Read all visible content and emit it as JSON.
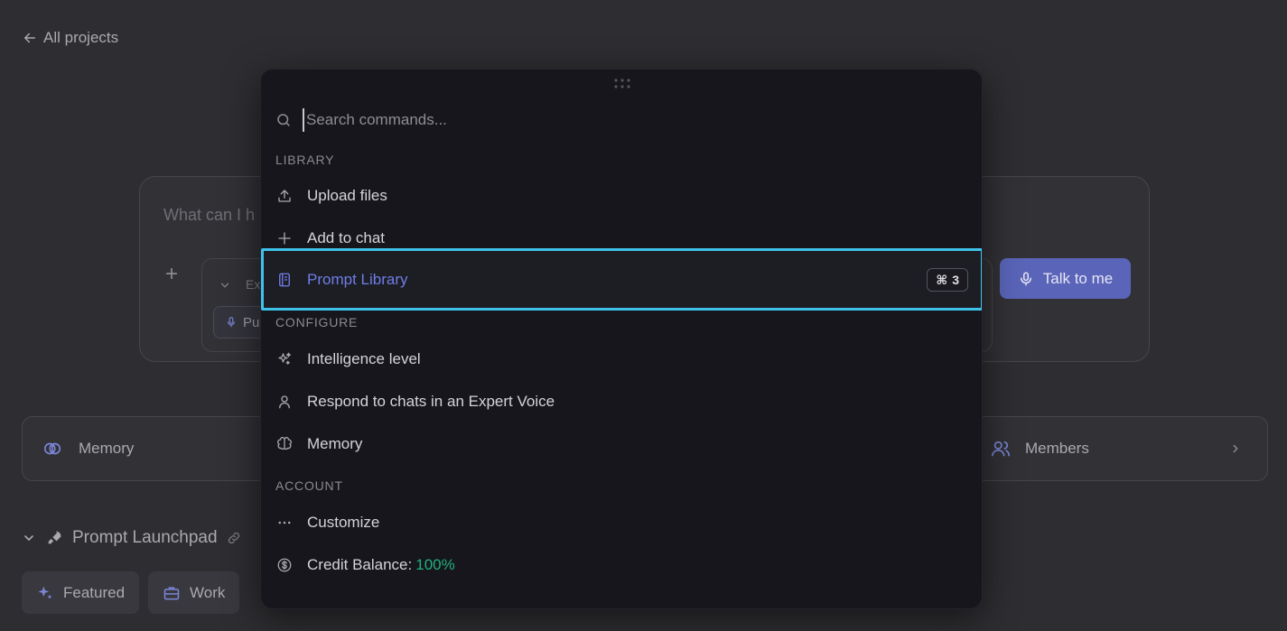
{
  "background": {
    "back_link": "All projects",
    "composer": {
      "placeholder": "What can I h",
      "collapsed_label": "Ex",
      "chip_label": "Pu",
      "talk_button": "Talk to me"
    },
    "strip": {
      "left_label": "Memory",
      "right_label": "Members"
    },
    "launchpad": {
      "title": "Prompt Launchpad",
      "tabs": [
        "Featured",
        "Work"
      ]
    }
  },
  "palette": {
    "search_placeholder": "Search commands...",
    "sections": [
      {
        "label": "LIBRARY",
        "items": [
          {
            "label": "Upload files",
            "icon": "upload-icon"
          },
          {
            "label": "Add to chat",
            "icon": "plus-icon"
          },
          {
            "label": "Prompt Library",
            "icon": "book-icon",
            "shortcut_symbol": "⌘",
            "shortcut_key": "3",
            "active": true
          }
        ]
      },
      {
        "label": "CONFIGURE",
        "items": [
          {
            "label": "Intelligence level",
            "icon": "sparkles-icon"
          },
          {
            "label": "Respond to chats in an Expert Voice",
            "icon": "user-icon"
          },
          {
            "label": "Memory",
            "icon": "brain-icon"
          }
        ]
      },
      {
        "label": "ACCOUNT",
        "items": [
          {
            "label": "Customize",
            "icon": "more-icon"
          },
          {
            "label": "Credit Balance:",
            "value": "100%",
            "icon": "dollar-icon"
          }
        ]
      }
    ]
  },
  "colors": {
    "accent_blue": "#6e7ee6",
    "highlight_border": "#3fc2ea",
    "credit_green": "#22b07a",
    "talk_button": "#5a64b8"
  }
}
